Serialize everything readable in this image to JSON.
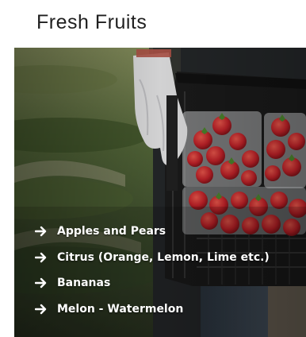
{
  "title": "Fresh Fruits",
  "items": [
    {
      "label": "Apples and Pears",
      "icon": "arrow-right-icon"
    },
    {
      "label": "Citrus (Orange, Lemon, Lime etc.)",
      "icon": "arrow-right-icon"
    },
    {
      "label": "Bananas",
      "icon": "arrow-right-icon"
    },
    {
      "label": "Melon - Watermelon",
      "icon": "arrow-right-icon"
    }
  ],
  "colors": {
    "text_on_photo": "#ffffff",
    "title_text": "#1f1f1f",
    "strawberry_red": "#c8232a",
    "crate_black": "#1d1d1d",
    "field_green": "#4b5d2f"
  }
}
